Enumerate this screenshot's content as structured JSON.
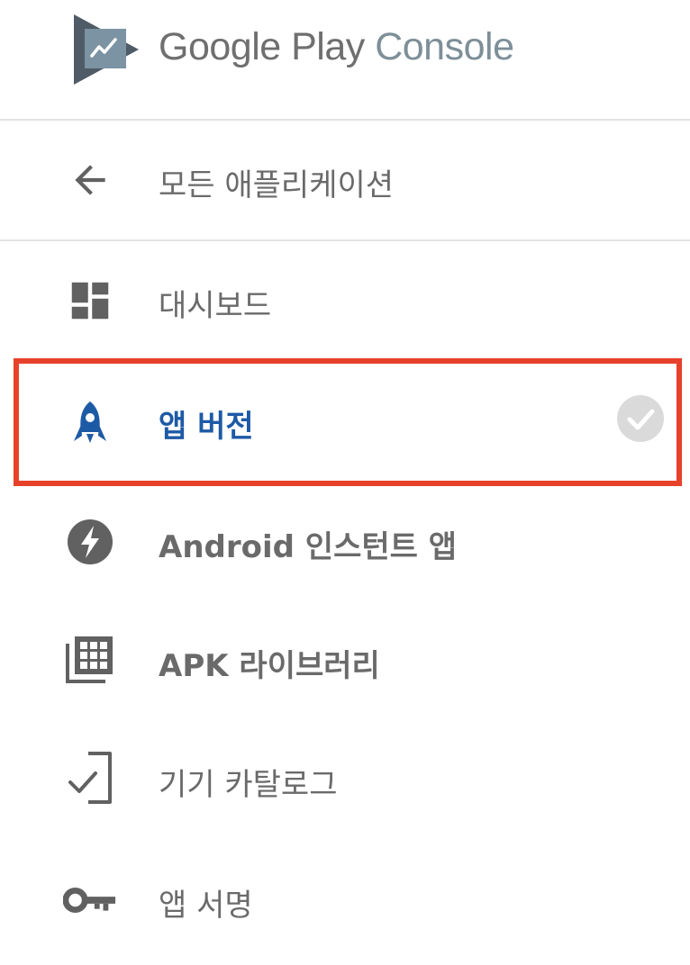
{
  "header": {
    "brand_google": "Google Play",
    "brand_console": "Console"
  },
  "back_link": {
    "label": "모든 애플리케이션",
    "icon": "arrow-back-icon"
  },
  "nav": {
    "items": [
      {
        "label": "대시보드",
        "icon": "dashboard-icon",
        "active": false
      },
      {
        "label": "앱 버전",
        "icon": "rocket-icon",
        "active": true,
        "status_icon": "check-circle-icon"
      },
      {
        "label": "Android 인스턴트 앱",
        "icon": "bolt-icon",
        "active": false
      },
      {
        "label": "APK 라이브러리",
        "icon": "apk-library-icon",
        "active": false
      },
      {
        "label": "기기 카탈로그",
        "icon": "device-check-icon",
        "active": false
      },
      {
        "label": "앱 서명",
        "icon": "key-icon",
        "active": false
      }
    ]
  },
  "colors": {
    "active_text": "#1d5aa6",
    "highlight_border": "#e8412a",
    "icon_gray": "#616161",
    "divider": "#e3e3e3"
  }
}
